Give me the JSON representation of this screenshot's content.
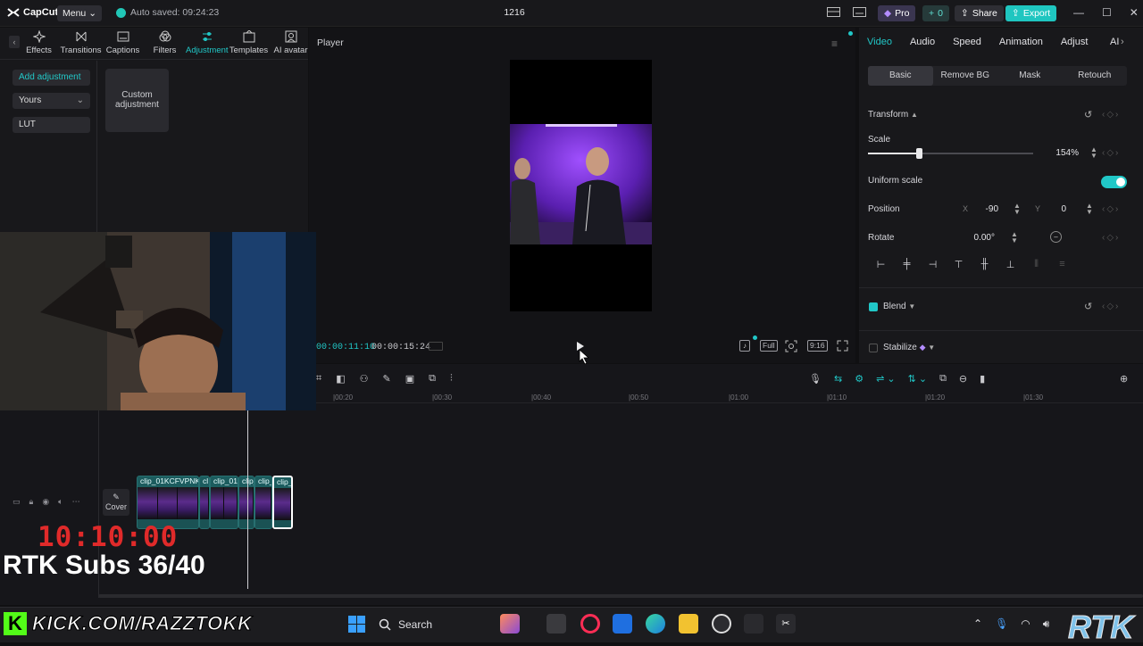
{
  "app": {
    "name": "CapCut",
    "menu_label": "Menu",
    "autosave": "Auto saved: 09:24:23",
    "project_title": "1216",
    "pro_label": "Pro",
    "coin_label": "0",
    "share_label": "Share",
    "export_label": "Export"
  },
  "left_panel": {
    "tabs": [
      {
        "label": "Effects",
        "icon": "sparkle-icon"
      },
      {
        "label": "Transitions",
        "icon": "transition-icon"
      },
      {
        "label": "Captions",
        "icon": "captions-icon"
      },
      {
        "label": "Filters",
        "icon": "filters-icon"
      },
      {
        "label": "Adjustment",
        "icon": "adjustment-icon",
        "active": true
      },
      {
        "label": "Templates",
        "icon": "templates-icon"
      },
      {
        "label": "AI avatar",
        "icon": "avatar-icon"
      }
    ],
    "sidebar": {
      "add_adjustment": "Add adjustment",
      "yours": "Yours",
      "lut": "LUT"
    },
    "custom_card": "Custom adjustment"
  },
  "player": {
    "title": "Player",
    "current_time": "00:00:11:10",
    "total_time": "00:00:15:24",
    "ctrl_full": "Full",
    "ctrl_ratio": "9:16"
  },
  "right_panel": {
    "tabs": [
      "Video",
      "Audio",
      "Speed",
      "Animation",
      "Adjust",
      "AI"
    ],
    "sub_tabs": [
      "Basic",
      "Remove BG",
      "Mask",
      "Retouch"
    ],
    "transform_label": "Transform",
    "scale_label": "Scale",
    "scale_value": "154%",
    "scale_fraction": 0.31,
    "uniform_scale_label": "Uniform scale",
    "uniform_scale_on": true,
    "position_label": "Position",
    "pos_x_label": "X",
    "pos_x": "-90",
    "pos_y_label": "Y",
    "pos_y": "0",
    "rotate_label": "Rotate",
    "rotate_value": "0.00°",
    "blend_label": "Blend",
    "blend_checked": true,
    "stabilize_label": "Stabilize"
  },
  "timeline": {
    "ruler": [
      "|00:20",
      "|00:30",
      "|00:40",
      "|00:50",
      "|01:00",
      "|01:10",
      "|01:20",
      "|01:30"
    ],
    "cover_label": "Cover",
    "clips": [
      {
        "label": "clip_01KCFVPNK"
      },
      {
        "label": "cl"
      },
      {
        "label": "clip_01"
      },
      {
        "label": "clip_"
      },
      {
        "label": "clip_"
      },
      {
        "label": "clip_"
      }
    ]
  },
  "overlay": {
    "counter": "10:10:00",
    "subs": "RTK Subs 36/40",
    "kick_url": "KICK.COM/RAZZTOKK",
    "kick_logo": "K",
    "rtk_logo": "RTK"
  },
  "taskbar": {
    "search_label": "Search"
  },
  "colors": {
    "accent": "#21c7c7",
    "export": "#1fc6c0",
    "counter": "#e02a2a",
    "kick": "#53fc18"
  }
}
